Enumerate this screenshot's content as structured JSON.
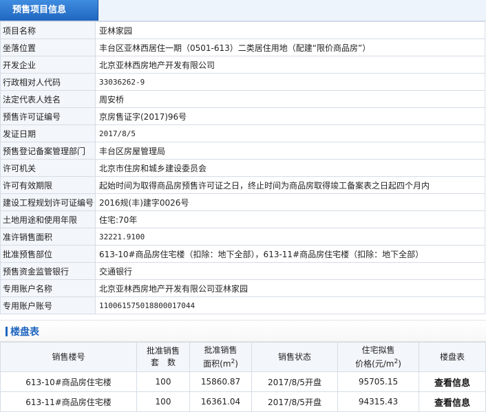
{
  "tab": {
    "title": "预售项目信息"
  },
  "info_rows": [
    {
      "label": "项目名称",
      "value": "亚林家园",
      "mono": false
    },
    {
      "label": "坐落位置",
      "value": "丰台区亚林西居住一期（0501-613）二类居住用地（配建“限价商品房”）",
      "mono": false
    },
    {
      "label": "开发企业",
      "value": "北京亚林西房地产开发有限公司",
      "mono": false
    },
    {
      "label": "行政相对人代码",
      "value": "33036262-9",
      "mono": true
    },
    {
      "label": "法定代表人姓名",
      "value": "周安桥",
      "mono": false
    },
    {
      "label": "预售许可证编号",
      "value": "京房售证字(2017)96号",
      "mono": false
    },
    {
      "label": "发证日期",
      "value": "2017/8/5",
      "mono": true
    },
    {
      "label": "预售登记备案管理部门",
      "value": "丰台区房屋管理局",
      "mono": false
    },
    {
      "label": "许可机关",
      "value": "北京市住房和城乡建设委员会",
      "mono": false
    },
    {
      "label": "许可有效期限",
      "value": "起始时间为取得商品房预售许可证之日，终止时间为商品房取得竣工备案表之日起四个月内",
      "mono": false
    },
    {
      "label": "建设工程规划许可证编号",
      "value": "2016规(丰)建字0026号",
      "mono": false
    },
    {
      "label": "土地用途和使用年限",
      "value": "住宅:70年",
      "mono": false
    },
    {
      "label": "准许销售面积",
      "value": "32221.9100",
      "mono": true
    },
    {
      "label": "批准预售部位",
      "value": "613-10#商品房住宅楼（扣除：地下全部），613-11#商品房住宅楼（扣除：地下全部）",
      "mono": false
    },
    {
      "label": "预售资金监管银行",
      "value": "交通银行",
      "mono": false
    },
    {
      "label": "专用账户名称",
      "value": "北京亚林西房地产开发有限公司亚林家园",
      "mono": false
    },
    {
      "label": "专用账户账号",
      "value": "110061575018800017044",
      "mono": true
    }
  ],
  "building_section": {
    "title": "楼盘表"
  },
  "building_table": {
    "headers": {
      "building": "销售楼号",
      "units_line1": "批准销售",
      "units_line2": "套　数",
      "area_line1": "批准销售",
      "area_line2": "面积(m",
      "area_sup": "2",
      "area_close": ")",
      "status": "销售状态",
      "price_line1": "住宅拟售",
      "price_line2": "价格(元/m",
      "price_sup": "2",
      "price_close": ")",
      "detail": "楼盘表"
    },
    "rows": [
      {
        "building": "613-10#商品房住宅楼",
        "units": "100",
        "area": "15860.87",
        "status": "2017/8/5开盘",
        "price": "95705.15",
        "link": "查看信息"
      },
      {
        "building": "613-11#商品房住宅楼",
        "units": "100",
        "area": "16361.04",
        "status": "2017/8/5开盘",
        "price": "94315.43",
        "link": "查看信息"
      }
    ]
  }
}
